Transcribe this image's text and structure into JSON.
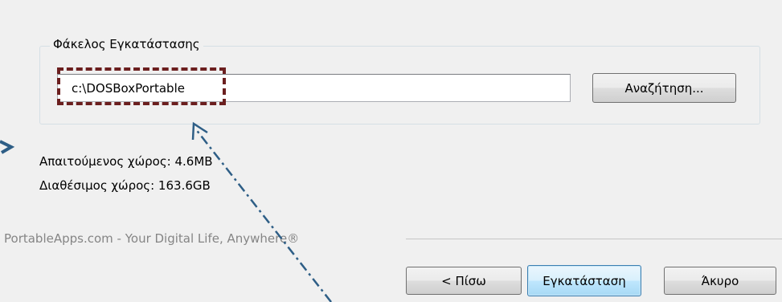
{
  "install_folder": {
    "legend": "Φάκελος Εγκατάστασης",
    "path_value": "c:\\DOSBoxPortable",
    "browse_label": "Αναζήτηση..."
  },
  "space": {
    "required": "Απαιτούμενος χώρος: 4.6MB",
    "available": "Διαθέσιμος χώρος: 163.6GB"
  },
  "branding": "PortableApps.com - Your Digital Life, Anywhere®",
  "buttons": {
    "back": "< Πίσω",
    "install": "Εγκατάσταση",
    "cancel": "Άκυρο"
  },
  "annotation": {
    "color": "#6b1f1f",
    "arrow_color": "#2e5e86"
  }
}
